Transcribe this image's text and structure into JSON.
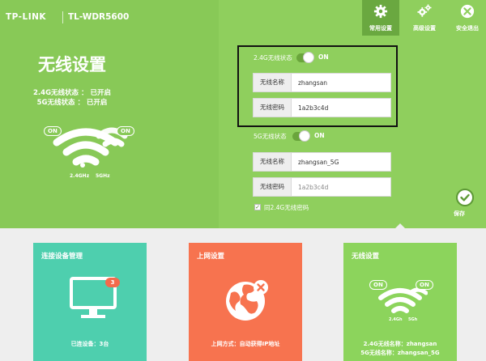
{
  "brand": {
    "logo": "TP-LINK",
    "model": "TL-WDR5600"
  },
  "nav": [
    {
      "label": "常用设置",
      "icon": "gear-icon",
      "active": true
    },
    {
      "label": "高级设置",
      "icon": "gears-icon",
      "active": false
    },
    {
      "label": "安全退出",
      "icon": "exit-icon",
      "active": false
    }
  ],
  "left_panel": {
    "title": "无线设置",
    "status_24": "2.4G无线状态 ： 已开启",
    "status_5": "5G无线状态 ： 已开启",
    "on_left": "ON",
    "on_right": "ON",
    "band_24": "2.4GHz",
    "band_5": "5GHz"
  },
  "form": {
    "band24": {
      "label": "2.4G无线状态",
      "toggle": "ON",
      "name_label": "无线名称",
      "name_value": "zhangsan",
      "pwd_label": "无线密码",
      "pwd_value": "1a2b3c4d"
    },
    "band5": {
      "label": "5G无线状态",
      "toggle": "ON",
      "name_label": "无线名称",
      "name_value": "zhangsan_5G",
      "pwd_label": "无线密码",
      "pwd_value": "1a2b3c4d"
    },
    "same_pwd_label": "同2.4G无线密码",
    "same_pwd_checked": true,
    "save_label": "保存"
  },
  "cards": [
    {
      "title": "连接设备管理",
      "badge": "3",
      "footer": "已连设备：3台",
      "color": "#4ecfae"
    },
    {
      "title": "上网设置",
      "footer": "上网方式：自动获得IP地址",
      "color": "#f7734f"
    },
    {
      "title": "无线设置",
      "on_left": "ON",
      "on_right": "ON",
      "band_24": "2.4Gh",
      "band_5": "5Gh",
      "footer1": "2.4G无线名称：zhangsan",
      "footer2": "5G无线名称：zhangsan_5G",
      "color": "#8cd45c"
    }
  ],
  "colors": {
    "accent_green": "#88c957",
    "highlight_border": "#111111"
  }
}
